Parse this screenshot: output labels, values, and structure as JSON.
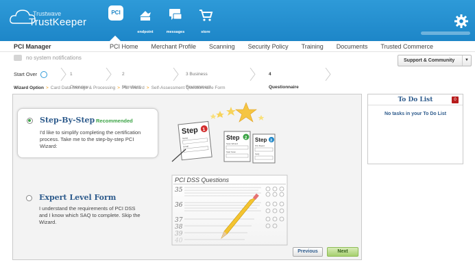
{
  "header": {
    "logo_line1": "Trustwave",
    "logo_line2": "TrustKeeper",
    "nav": [
      {
        "label": "",
        "icon": "pci-icon"
      },
      {
        "label": "endpoint",
        "icon": "endpoint-icon"
      },
      {
        "label": "messages",
        "icon": "messages-icon"
      },
      {
        "label": "store",
        "icon": "store-cart-icon"
      }
    ],
    "pci_badge": "PCI",
    "settings_icon": "gear-icon",
    "colors": {
      "bar": "#1d86c8",
      "accent_green": "#3ba345",
      "title_blue": "#2e5b8c"
    }
  },
  "appnav": {
    "title": "PCI Manager",
    "menu": [
      "PCI Home",
      "Merchant Profile",
      "Scanning",
      "Security Policy",
      "Training",
      "Documents",
      "Trusted Commerce"
    ]
  },
  "notifications": {
    "text": "no system notifications"
  },
  "support": {
    "label": "Support & Community"
  },
  "wizard": {
    "start_over": "Start Over",
    "steps": [
      "1 Overview",
      "2 Merchant Profile",
      "3 Business Environment",
      "4 Questionnaire"
    ],
    "current_step": 3
  },
  "breadcrumb": {
    "first": "Wizard Option",
    "items": [
      "Card Data Storage & Processing",
      "PCI Wizard",
      "Self-Assessment Questionnaire Form"
    ]
  },
  "options": {
    "step": {
      "title": "Step-By-Step",
      "badge": "Recommended",
      "desc1": "I'd like to simplify completing the certification",
      "desc2": "process. Take me to the step-by-step PCI",
      "desc3": "Wizard:",
      "selected": true
    },
    "expert": {
      "title": "Expert Level Form",
      "desc1": "I understand the requirements of PCI DSS",
      "desc2": "and I know which SAQ to complete.  Skip the",
      "desc3": "Wizard.",
      "selected": false
    }
  },
  "illustration": {
    "step1": "Step",
    "step2": "Step",
    "step3": "Step",
    "n1": "1",
    "n2": "2",
    "n3": "3",
    "card1_f1": "Name",
    "card1_f2": "Email",
    "card2_f1": "Scan Wizard",
    "card2_f2": "Start Scan",
    "card3_f1": "PCI Board",
    "card3_f2": "SAQ",
    "form_title": "PCI DSS Questions",
    "form_nums": [
      "35",
      "36",
      "37",
      "38",
      "39",
      "40"
    ]
  },
  "buttons": {
    "previous": "Previous",
    "next": "Next"
  },
  "todo": {
    "title": "To Do List",
    "count": "0",
    "empty": "No tasks in your To Do List"
  }
}
